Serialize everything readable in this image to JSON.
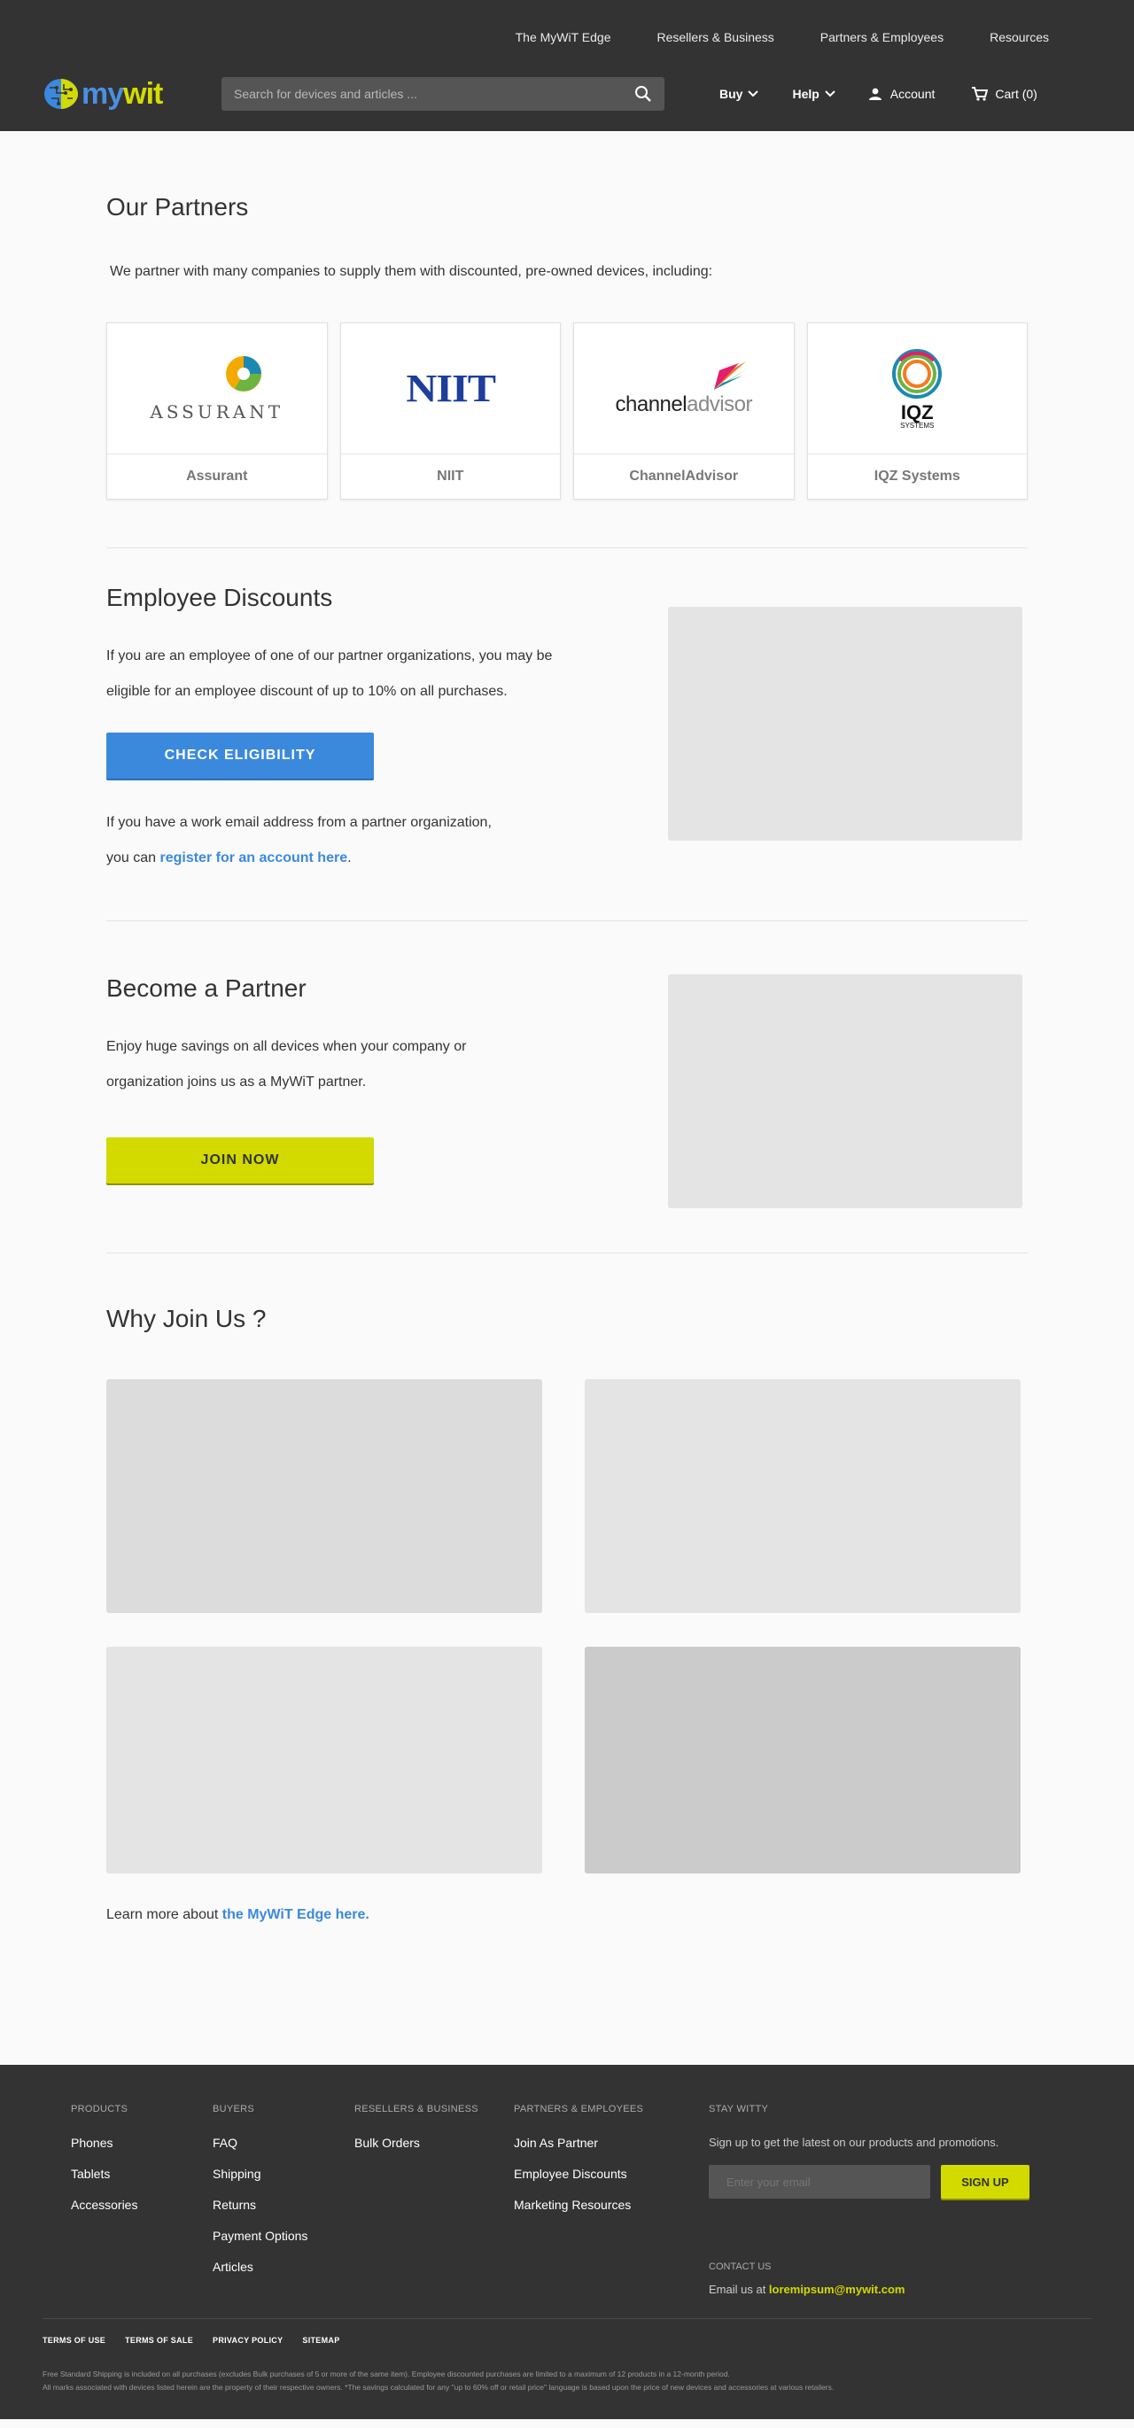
{
  "header": {
    "topnav": [
      "The MyWiT Edge",
      "Resellers & Business",
      "Partners & Employees",
      "Resources"
    ],
    "logo": {
      "my": "my",
      "wit": "wit"
    },
    "search_placeholder": "Search for devices and articles ...",
    "buy_label": "Buy",
    "help_label": "Help",
    "account_label": "Account",
    "cart_label": "Cart (0)"
  },
  "partners_section": {
    "title": "Our Partners",
    "intro": "We partner with many companies to supply them with discounted, pre-owned devices, including:",
    "partners": [
      {
        "name": "Assurant",
        "logo_text": "ASSURANT"
      },
      {
        "name": "NIIT",
        "logo_text": "NIIT"
      },
      {
        "name": "ChannelAdvisor",
        "logo_text_a": "channel",
        "logo_text_b": "advisor"
      },
      {
        "name": "IQZ Systems",
        "logo_text": "IQZ",
        "logo_sub": "SYSTEMS"
      }
    ]
  },
  "employee_section": {
    "title": "Employee Discounts",
    "para1_line1": "If you are an employee of one of our partner organizations, you may be",
    "para1_line2": "eligible for an employee discount of up to 10% on all purchases.",
    "button": "CHECK ELIGIBILITY",
    "para2_line1": "If you have a work email address from a partner organization,",
    "para2_prefix": "you can ",
    "para2_link": "register for an account here",
    "para2_suffix": "."
  },
  "become_section": {
    "title": "Become a Partner",
    "para_line1": "Enjoy huge savings on all devices when your company or",
    "para_line2": "organization joins us as a MyWiT partner.",
    "button": "JOIN NOW"
  },
  "why_section": {
    "title": "Why Join Us ?",
    "learn_prefix": "Learn more about ",
    "learn_link": "the MyWiT Edge here."
  },
  "footer": {
    "columns": [
      {
        "heading": "PRODUCTS",
        "links": [
          "Phones",
          "Tablets",
          "Accessories"
        ]
      },
      {
        "heading": "BUYERS",
        "links": [
          "FAQ",
          "Shipping",
          "Returns",
          "Payment Options",
          "Articles"
        ]
      },
      {
        "heading": "RESELLERS & BUSINESS",
        "links": [
          "Bulk Orders"
        ]
      },
      {
        "heading": "PARTNERS & EMPLOYEES",
        "links": [
          "Join As Partner",
          "Employee Discounts",
          "Marketing Resources"
        ]
      }
    ],
    "stay_heading": "STAY WITTY",
    "stay_text": "Sign up to get the latest on our products and promotions.",
    "email_placeholder": "Enter your email",
    "signup_label": "SIGN UP",
    "contact_heading": "CONTACT US",
    "contact_prefix": "Email us at ",
    "contact_email": "loremipsum@mywit.com",
    "legal_links": [
      "TERMS OF USE",
      "TERMS OF SALE",
      "PRIVACY POLICY",
      "SITEMAP"
    ],
    "fine_line1": "Free Standard Shipping is included on all purchases (excludes Bulk purchases of 5 or more of the same item). Employee discounted purchases are limited to a maximum of 12 products in a 12-month period.",
    "fine_line2": "All marks associated with devices listed herein are the property of their respective owners. *The savings calculated for any \"up to 60% off or retail price\" language is based upon the price of new devices and accessories at various retailers."
  }
}
